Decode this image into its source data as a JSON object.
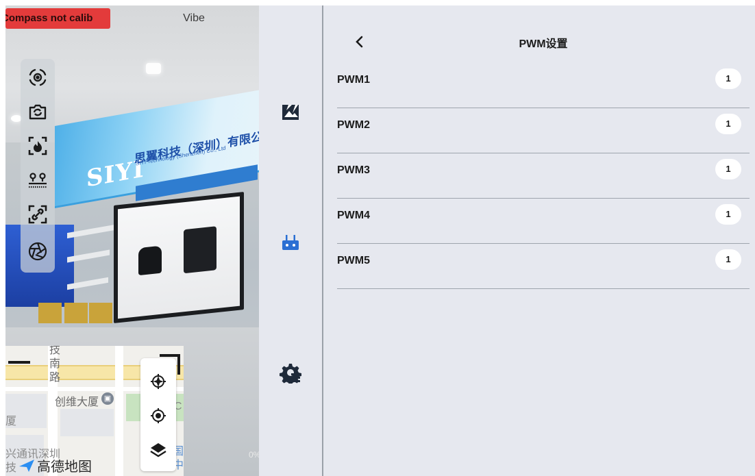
{
  "camera": {
    "compass_warning": "Compass not calib",
    "vibe_label": "Vibe",
    "scene": {
      "sign_logo": "SIYI",
      "sign_text": "思翼科技（深圳）有限公司",
      "sign_sub": "SIYI Technology (Shenzhen) Co., Ltd"
    },
    "tools": [
      {
        "icon": "gimbal-center-icon"
      },
      {
        "icon": "camera-switch-icon"
      },
      {
        "icon": "thermal-icon"
      },
      {
        "icon": "ranging-icon"
      },
      {
        "icon": "link-icon"
      },
      {
        "icon": "aperture-icon"
      }
    ],
    "zoom": "0%"
  },
  "map": {
    "labels": {
      "road_1": "技",
      "road_2": "南",
      "road_3": "路",
      "building": "创维大厦",
      "edge_left": "厦",
      "edge_c": "C",
      "bottom_1": "兴通讯深圳",
      "bottom_2": "技",
      "bottom_3": "国",
      "bottom_4": "中"
    },
    "logo_text": "高德地图",
    "buttons": [
      {
        "icon": "aircraft-locate-icon"
      },
      {
        "icon": "my-location-icon"
      },
      {
        "icon": "layers-icon"
      }
    ]
  },
  "rail": {
    "items": [
      {
        "icon": "gallery-icon"
      },
      {
        "icon": "remote-controller-icon"
      },
      {
        "icon": "settings-gear-icon"
      }
    ]
  },
  "settings": {
    "title": "PWM设置",
    "rows": [
      {
        "label": "PWM1",
        "value": "1"
      },
      {
        "label": "PWM2",
        "value": "1"
      },
      {
        "label": "PWM3",
        "value": "1"
      },
      {
        "label": "PWM4",
        "value": "1"
      },
      {
        "label": "PWM5",
        "value": "1"
      }
    ]
  },
  "colors": {
    "warning": "#e33b3b",
    "panel_bg": "#e6e8ef",
    "divider": "#9ea4ad"
  }
}
